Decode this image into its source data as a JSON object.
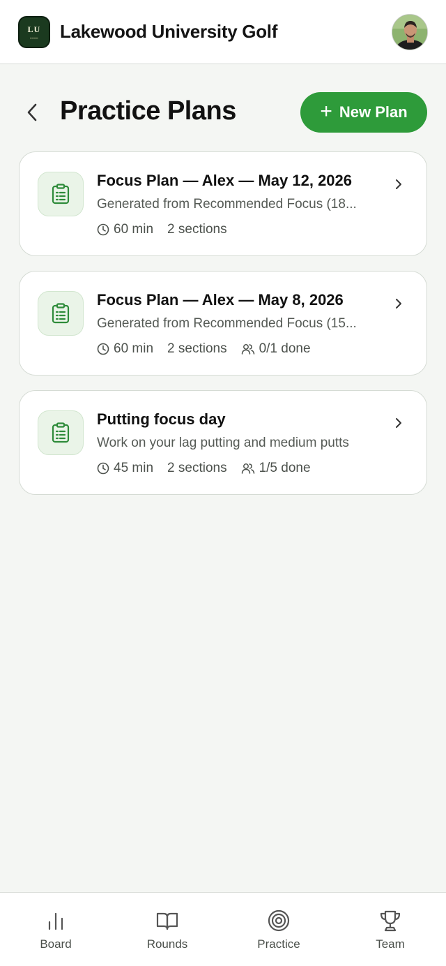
{
  "header": {
    "app_title": "Lakewood University Golf",
    "logo_text": "LU"
  },
  "page": {
    "title": "Practice Plans",
    "new_plan_label": "New Plan"
  },
  "plans": [
    {
      "title": "Focus Plan — Alex — May 12, 2026",
      "description": "Generated from Recommended Focus (18...",
      "duration": "60 min",
      "sections": "2 sections",
      "done": ""
    },
    {
      "title": "Focus Plan — Alex — May 8, 2026",
      "description": "Generated from Recommended Focus (15...",
      "duration": "60 min",
      "sections": "2 sections",
      "done": "0/1 done"
    },
    {
      "title": "Putting focus day",
      "description": "Work on your lag putting and medium putts",
      "duration": "45 min",
      "sections": "2 sections",
      "done": "1/5 done"
    }
  ],
  "nav": {
    "items": [
      {
        "label": "Board",
        "icon": "bar-chart-icon"
      },
      {
        "label": "Rounds",
        "icon": "book-icon"
      },
      {
        "label": "Practice",
        "icon": "target-icon"
      },
      {
        "label": "Team",
        "icon": "trophy-icon"
      }
    ]
  },
  "colors": {
    "accent": "#2e9b3a",
    "background": "#f4f6f3",
    "card": "#ffffff",
    "icon_tile": "#eaf4e8"
  }
}
